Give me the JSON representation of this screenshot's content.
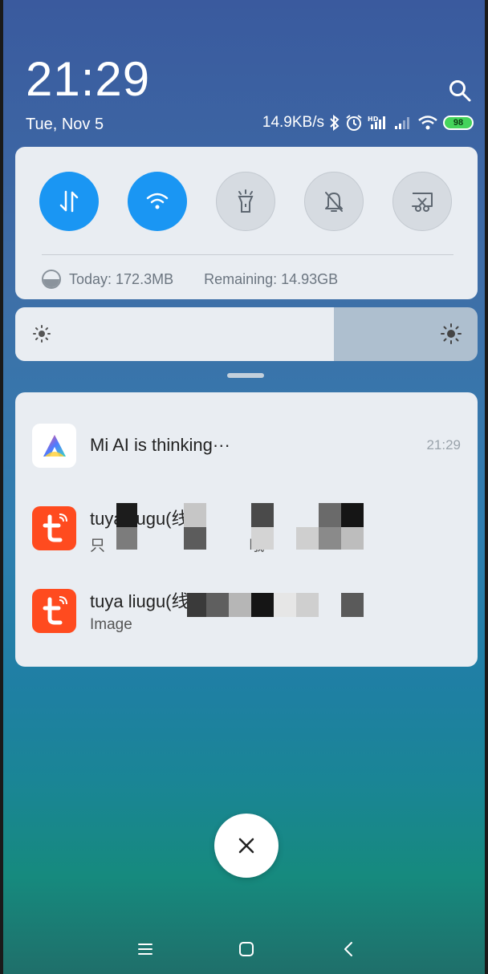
{
  "clock": {
    "time": "21:29",
    "date": "Tue, Nov 5"
  },
  "status_bar": {
    "net_speed": "14.9KB/s",
    "battery": "98"
  },
  "quick_settings": {
    "toggles": [
      {
        "name": "mobile-data",
        "state": "on"
      },
      {
        "name": "wifi",
        "state": "on"
      },
      {
        "name": "flashlight",
        "state": "off"
      },
      {
        "name": "silent",
        "state": "off"
      },
      {
        "name": "screenshot",
        "state": "off"
      }
    ],
    "data_today": "Today: 172.3MB",
    "data_remaining": "Remaining: 14.93GB"
  },
  "brightness": {
    "level": 0.69
  },
  "notifications": [
    {
      "app": "Mi AI",
      "title": "Mi AI is thinking···",
      "time": "21:29"
    },
    {
      "app": "Tuya",
      "title": "tuya liugu(线",
      "subtitle": "只                                  哦"
    },
    {
      "app": "Tuya",
      "title": "tuya liugu(线",
      "subtitle": "Image"
    }
  ],
  "colors": {
    "accent": "#1a96f3",
    "tuya": "#ff4b1f"
  }
}
